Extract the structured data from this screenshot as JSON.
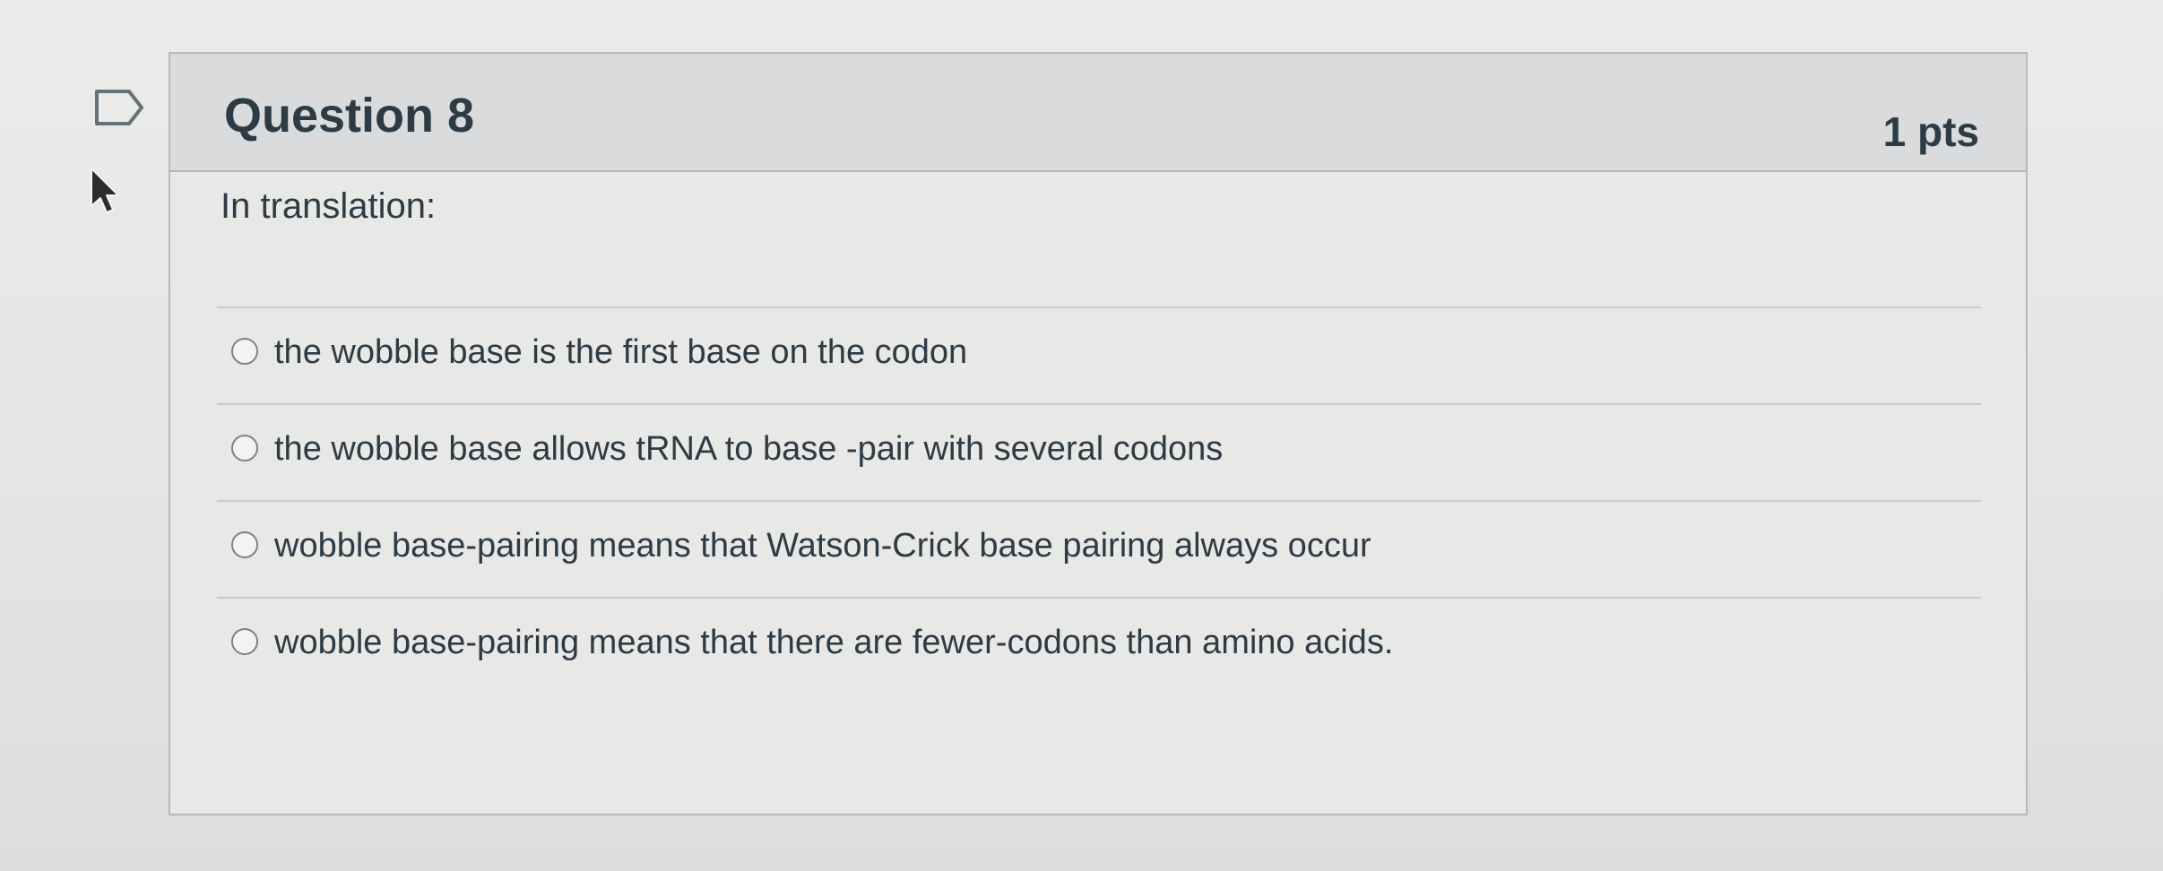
{
  "icons": {
    "flag": "flag-icon",
    "cursor": "mouse-pointer-icon"
  },
  "question": {
    "title": "Question 8",
    "points": "1 pts",
    "prompt": "In translation:",
    "answers": [
      {
        "label": "the wobble base is the first base on the codon"
      },
      {
        "label": "the wobble base allows tRNA to base -pair with several codons"
      },
      {
        "label": "wobble base-pairing means that Watson-Crick base pairing always occur"
      },
      {
        "label": "wobble base-pairing means that there are fewer-codons than amino acids."
      }
    ]
  },
  "colors": {
    "header_background": "#d9dbdc",
    "card_border": "#b7b9bb",
    "text": "#2d3b45",
    "radio_border": "#7b8288"
  }
}
